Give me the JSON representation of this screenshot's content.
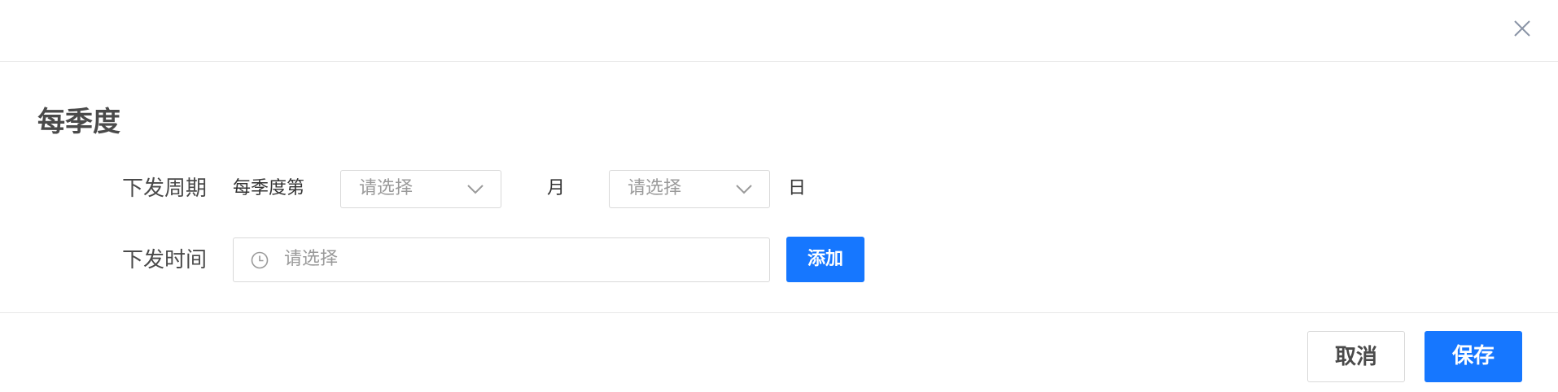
{
  "colors": {
    "primary": "#1677ff",
    "border": "#d9d9d9",
    "placeholder": "#9a9a9a",
    "label": "#4a4a4a"
  },
  "header": {
    "close_icon": "close-icon"
  },
  "section": {
    "title": "每季度"
  },
  "form": {
    "cycle": {
      "label": "下发周期",
      "prefix": "每季度第",
      "month_select": {
        "placeholder": "请选择",
        "icon": "chevron-down-icon"
      },
      "month_unit": "月",
      "day_select": {
        "placeholder": "请选择",
        "icon": "chevron-down-icon"
      },
      "day_unit": "日"
    },
    "time": {
      "label": "下发时间",
      "placeholder": "请选择",
      "icon": "clock-icon",
      "add_label": "添加"
    }
  },
  "footer": {
    "cancel_label": "取消",
    "save_label": "保存"
  }
}
